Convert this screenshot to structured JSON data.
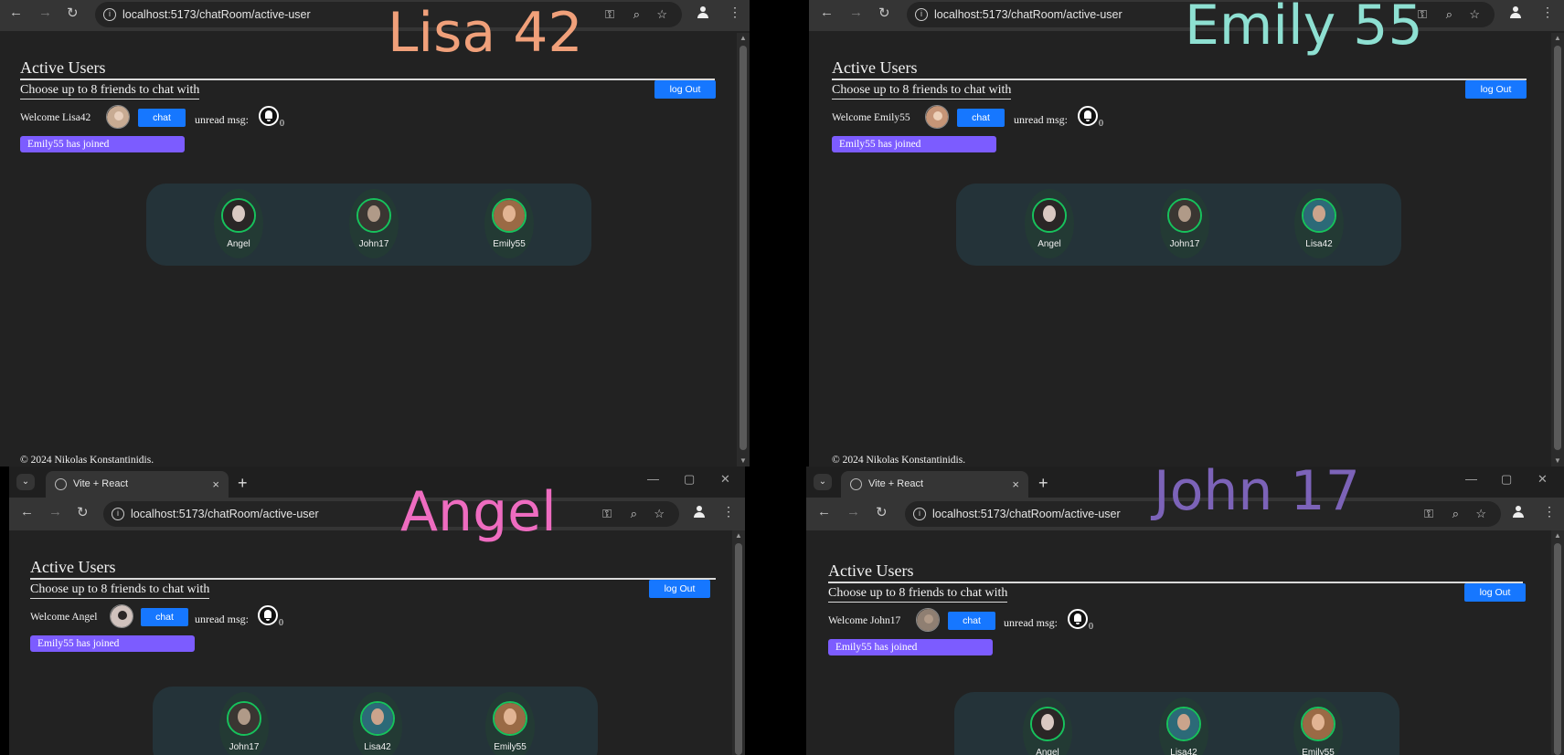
{
  "browser": {
    "url": "localhost:5173/chatRoom/active-user",
    "tab_title": "Vite + React",
    "tab_close": "×",
    "new_tab": "+",
    "tab_menu": "⌄",
    "minimize": "—",
    "maximize": "▢",
    "close": "✕"
  },
  "page": {
    "heading": "Active Users",
    "subheading": "Choose up to 8 friends to chat with",
    "logout_label": "log Out",
    "chat_label": "chat",
    "unread_label": "unread msg:",
    "unread_count": "0",
    "notification": "Emily55 has joined",
    "footer": "© 2024 Nikolas Konstantinidis."
  },
  "windows": [
    {
      "overlay_label": "Lisa 42",
      "overlay_color": "#f0a07a",
      "welcome": "Welcome Lisa42",
      "self_avatar": "#c8ab93",
      "users": [
        {
          "name": "Angel",
          "avatar": "#2a2626",
          "face": "#d9c8c2"
        },
        {
          "name": "John17",
          "avatar": "#3a3632",
          "face": "#b09a88"
        },
        {
          "name": "Emily55",
          "avatar": "#9a6a45",
          "face": "#e2b493"
        }
      ]
    },
    {
      "overlay_label": "Emily 55",
      "overlay_color": "#8ee0d2",
      "welcome": "Welcome Emily55",
      "self_avatar": "#c69577",
      "users": [
        {
          "name": "Angel",
          "avatar": "#2a2626",
          "face": "#d9c8c2"
        },
        {
          "name": "John17",
          "avatar": "#3a3632",
          "face": "#b09a88"
        },
        {
          "name": "Lisa42",
          "avatar": "#2c6a78",
          "face": "#caa48c"
        }
      ]
    },
    {
      "overlay_label": "Angel",
      "overlay_color": "#ee6cc0",
      "welcome": "Welcome Angel",
      "self_avatar": "#d0c2bd",
      "users": [
        {
          "name": "John17",
          "avatar": "#3a3632",
          "face": "#b09a88"
        },
        {
          "name": "Lisa42",
          "avatar": "#2c6a78",
          "face": "#caa48c"
        },
        {
          "name": "Emily55",
          "avatar": "#9a6a45",
          "face": "#e2b493"
        }
      ]
    },
    {
      "overlay_label": "John 17",
      "overlay_color": "#7c63b8",
      "welcome": "Welcome John17",
      "self_avatar": "#8f7f72",
      "users": [
        {
          "name": "Angel",
          "avatar": "#2a2626",
          "face": "#d9c8c2"
        },
        {
          "name": "Lisa42",
          "avatar": "#2c6a78",
          "face": "#caa48c"
        },
        {
          "name": "Emily55",
          "avatar": "#9a6a45",
          "face": "#e2b493"
        }
      ]
    }
  ],
  "colors": {
    "accent_button": "#1677ff",
    "notice": "#7c5cff",
    "online_ring": "#17c25c",
    "panel": "#243339"
  }
}
